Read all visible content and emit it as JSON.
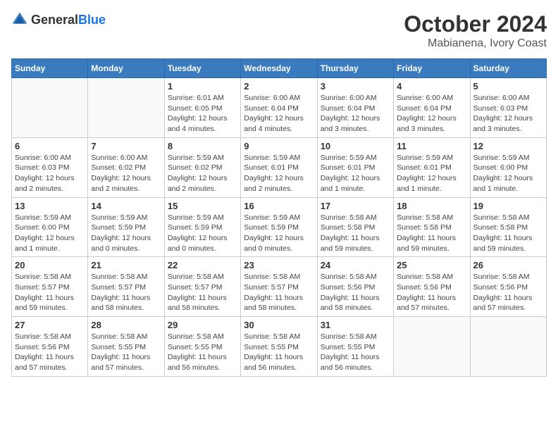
{
  "header": {
    "logo_general": "General",
    "logo_blue": "Blue",
    "month": "October 2024",
    "location": "Mabianena, Ivory Coast"
  },
  "weekdays": [
    "Sunday",
    "Monday",
    "Tuesday",
    "Wednesday",
    "Thursday",
    "Friday",
    "Saturday"
  ],
  "weeks": [
    [
      {
        "day": "",
        "info": ""
      },
      {
        "day": "",
        "info": ""
      },
      {
        "day": "1",
        "info": "Sunrise: 6:01 AM\nSunset: 6:05 PM\nDaylight: 12 hours\nand 4 minutes."
      },
      {
        "day": "2",
        "info": "Sunrise: 6:00 AM\nSunset: 6:04 PM\nDaylight: 12 hours\nand 4 minutes."
      },
      {
        "day": "3",
        "info": "Sunrise: 6:00 AM\nSunset: 6:04 PM\nDaylight: 12 hours\nand 3 minutes."
      },
      {
        "day": "4",
        "info": "Sunrise: 6:00 AM\nSunset: 6:04 PM\nDaylight: 12 hours\nand 3 minutes."
      },
      {
        "day": "5",
        "info": "Sunrise: 6:00 AM\nSunset: 6:03 PM\nDaylight: 12 hours\nand 3 minutes."
      }
    ],
    [
      {
        "day": "6",
        "info": "Sunrise: 6:00 AM\nSunset: 6:03 PM\nDaylight: 12 hours\nand 2 minutes."
      },
      {
        "day": "7",
        "info": "Sunrise: 6:00 AM\nSunset: 6:02 PM\nDaylight: 12 hours\nand 2 minutes."
      },
      {
        "day": "8",
        "info": "Sunrise: 5:59 AM\nSunset: 6:02 PM\nDaylight: 12 hours\nand 2 minutes."
      },
      {
        "day": "9",
        "info": "Sunrise: 5:59 AM\nSunset: 6:01 PM\nDaylight: 12 hours\nand 2 minutes."
      },
      {
        "day": "10",
        "info": "Sunrise: 5:59 AM\nSunset: 6:01 PM\nDaylight: 12 hours\nand 1 minute."
      },
      {
        "day": "11",
        "info": "Sunrise: 5:59 AM\nSunset: 6:01 PM\nDaylight: 12 hours\nand 1 minute."
      },
      {
        "day": "12",
        "info": "Sunrise: 5:59 AM\nSunset: 6:00 PM\nDaylight: 12 hours\nand 1 minute."
      }
    ],
    [
      {
        "day": "13",
        "info": "Sunrise: 5:59 AM\nSunset: 6:00 PM\nDaylight: 12 hours\nand 1 minute."
      },
      {
        "day": "14",
        "info": "Sunrise: 5:59 AM\nSunset: 5:59 PM\nDaylight: 12 hours\nand 0 minutes."
      },
      {
        "day": "15",
        "info": "Sunrise: 5:59 AM\nSunset: 5:59 PM\nDaylight: 12 hours\nand 0 minutes."
      },
      {
        "day": "16",
        "info": "Sunrise: 5:59 AM\nSunset: 5:59 PM\nDaylight: 12 hours\nand 0 minutes."
      },
      {
        "day": "17",
        "info": "Sunrise: 5:58 AM\nSunset: 5:58 PM\nDaylight: 11 hours\nand 59 minutes."
      },
      {
        "day": "18",
        "info": "Sunrise: 5:58 AM\nSunset: 5:58 PM\nDaylight: 11 hours\nand 59 minutes."
      },
      {
        "day": "19",
        "info": "Sunrise: 5:58 AM\nSunset: 5:58 PM\nDaylight: 11 hours\nand 59 minutes."
      }
    ],
    [
      {
        "day": "20",
        "info": "Sunrise: 5:58 AM\nSunset: 5:57 PM\nDaylight: 11 hours\nand 59 minutes."
      },
      {
        "day": "21",
        "info": "Sunrise: 5:58 AM\nSunset: 5:57 PM\nDaylight: 11 hours\nand 58 minutes."
      },
      {
        "day": "22",
        "info": "Sunrise: 5:58 AM\nSunset: 5:57 PM\nDaylight: 11 hours\nand 58 minutes."
      },
      {
        "day": "23",
        "info": "Sunrise: 5:58 AM\nSunset: 5:57 PM\nDaylight: 11 hours\nand 58 minutes."
      },
      {
        "day": "24",
        "info": "Sunrise: 5:58 AM\nSunset: 5:56 PM\nDaylight: 11 hours\nand 58 minutes."
      },
      {
        "day": "25",
        "info": "Sunrise: 5:58 AM\nSunset: 5:56 PM\nDaylight: 11 hours\nand 57 minutes."
      },
      {
        "day": "26",
        "info": "Sunrise: 5:58 AM\nSunset: 5:56 PM\nDaylight: 11 hours\nand 57 minutes."
      }
    ],
    [
      {
        "day": "27",
        "info": "Sunrise: 5:58 AM\nSunset: 5:56 PM\nDaylight: 11 hours\nand 57 minutes."
      },
      {
        "day": "28",
        "info": "Sunrise: 5:58 AM\nSunset: 5:55 PM\nDaylight: 11 hours\nand 57 minutes."
      },
      {
        "day": "29",
        "info": "Sunrise: 5:58 AM\nSunset: 5:55 PM\nDaylight: 11 hours\nand 56 minutes."
      },
      {
        "day": "30",
        "info": "Sunrise: 5:58 AM\nSunset: 5:55 PM\nDaylight: 11 hours\nand 56 minutes."
      },
      {
        "day": "31",
        "info": "Sunrise: 5:58 AM\nSunset: 5:55 PM\nDaylight: 11 hours\nand 56 minutes."
      },
      {
        "day": "",
        "info": ""
      },
      {
        "day": "",
        "info": ""
      }
    ]
  ]
}
